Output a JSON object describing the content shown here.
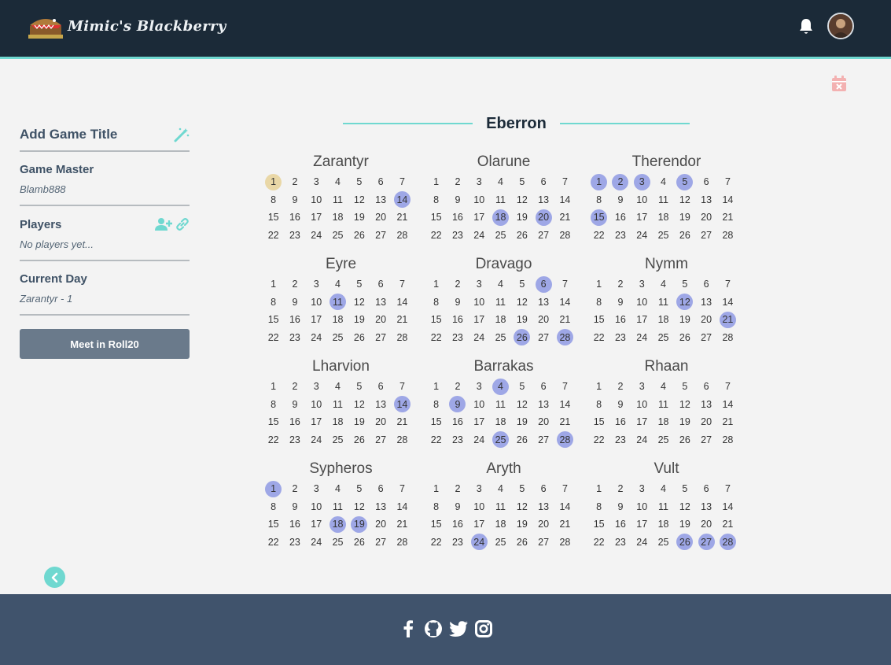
{
  "header": {
    "brand": "Mimic's Blackberry",
    "icons": [
      "bell-icon",
      "user-avatar"
    ]
  },
  "sidebar": {
    "game_title": "Add Game Title",
    "game_master_label": "Game Master",
    "game_master_value": "Blamb888",
    "players_label": "Players",
    "players_value": "No players yet...",
    "current_day_label": "Current Day",
    "current_day_value": "Zarantyr - 1",
    "roll20_button": "Meet in Roll20"
  },
  "calendar": {
    "title": "Eberron",
    "current": {
      "month": 0,
      "day": 1
    },
    "months": [
      {
        "name": "Zarantyr",
        "events": [
          14
        ]
      },
      {
        "name": "Olarune",
        "events": [
          18,
          20
        ]
      },
      {
        "name": "Therendor",
        "events": [
          1,
          2,
          3,
          5,
          15
        ]
      },
      {
        "name": "Eyre",
        "events": [
          11
        ]
      },
      {
        "name": "Dravago",
        "events": [
          6,
          26,
          28
        ]
      },
      {
        "name": "Nymm",
        "events": [
          12,
          21
        ]
      },
      {
        "name": "Lharvion",
        "events": [
          14
        ]
      },
      {
        "name": "Barrakas",
        "events": [
          4,
          9,
          25,
          28
        ]
      },
      {
        "name": "Rhaan",
        "events": []
      },
      {
        "name": "Sypheros",
        "events": [
          1,
          18,
          19
        ]
      },
      {
        "name": "Aryth",
        "events": [
          24
        ]
      },
      {
        "name": "Vult",
        "events": [
          26,
          27,
          28
        ]
      }
    ]
  },
  "colors": {
    "accent": "#6fd8d0",
    "event": "#9ea7e6",
    "current_day": "#e9d7a6",
    "header_bg": "#1b2a38",
    "footer_bg": "#40536c"
  },
  "footer": {
    "social": [
      "facebook-icon",
      "github-icon",
      "twitter-icon",
      "instagram-icon"
    ]
  }
}
